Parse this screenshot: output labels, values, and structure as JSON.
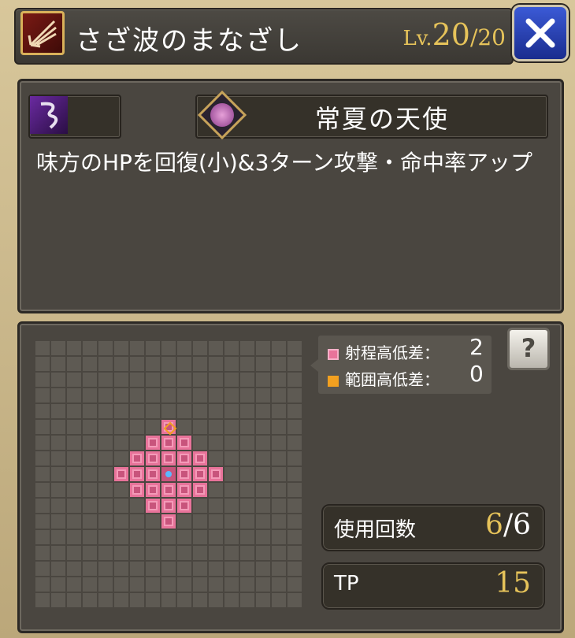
{
  "title": {
    "skill_name": "さざ波のまなざし",
    "level_label": "Lv.",
    "level_current": "20",
    "level_max": "/20"
  },
  "skill": {
    "unit_name": "常夏の天使",
    "description": "味方のHPを回復(小)&3ターン攻撃・命中率アップ"
  },
  "legend": {
    "range_height_label": "射程高低差：",
    "range_height_value": "2",
    "area_height_label": "範囲高低差：",
    "area_height_value": "0"
  },
  "stats": {
    "uses_label": "使用回数",
    "uses_current": "6",
    "uses_max": "/6",
    "tp_label": "TP",
    "tp_value": "15"
  },
  "help_icon": "?",
  "colors": {
    "gold": "#e6c35a",
    "range_pink": "#e8739a",
    "area_orange": "#f2a020",
    "close_blue": "#2f4bc4"
  }
}
